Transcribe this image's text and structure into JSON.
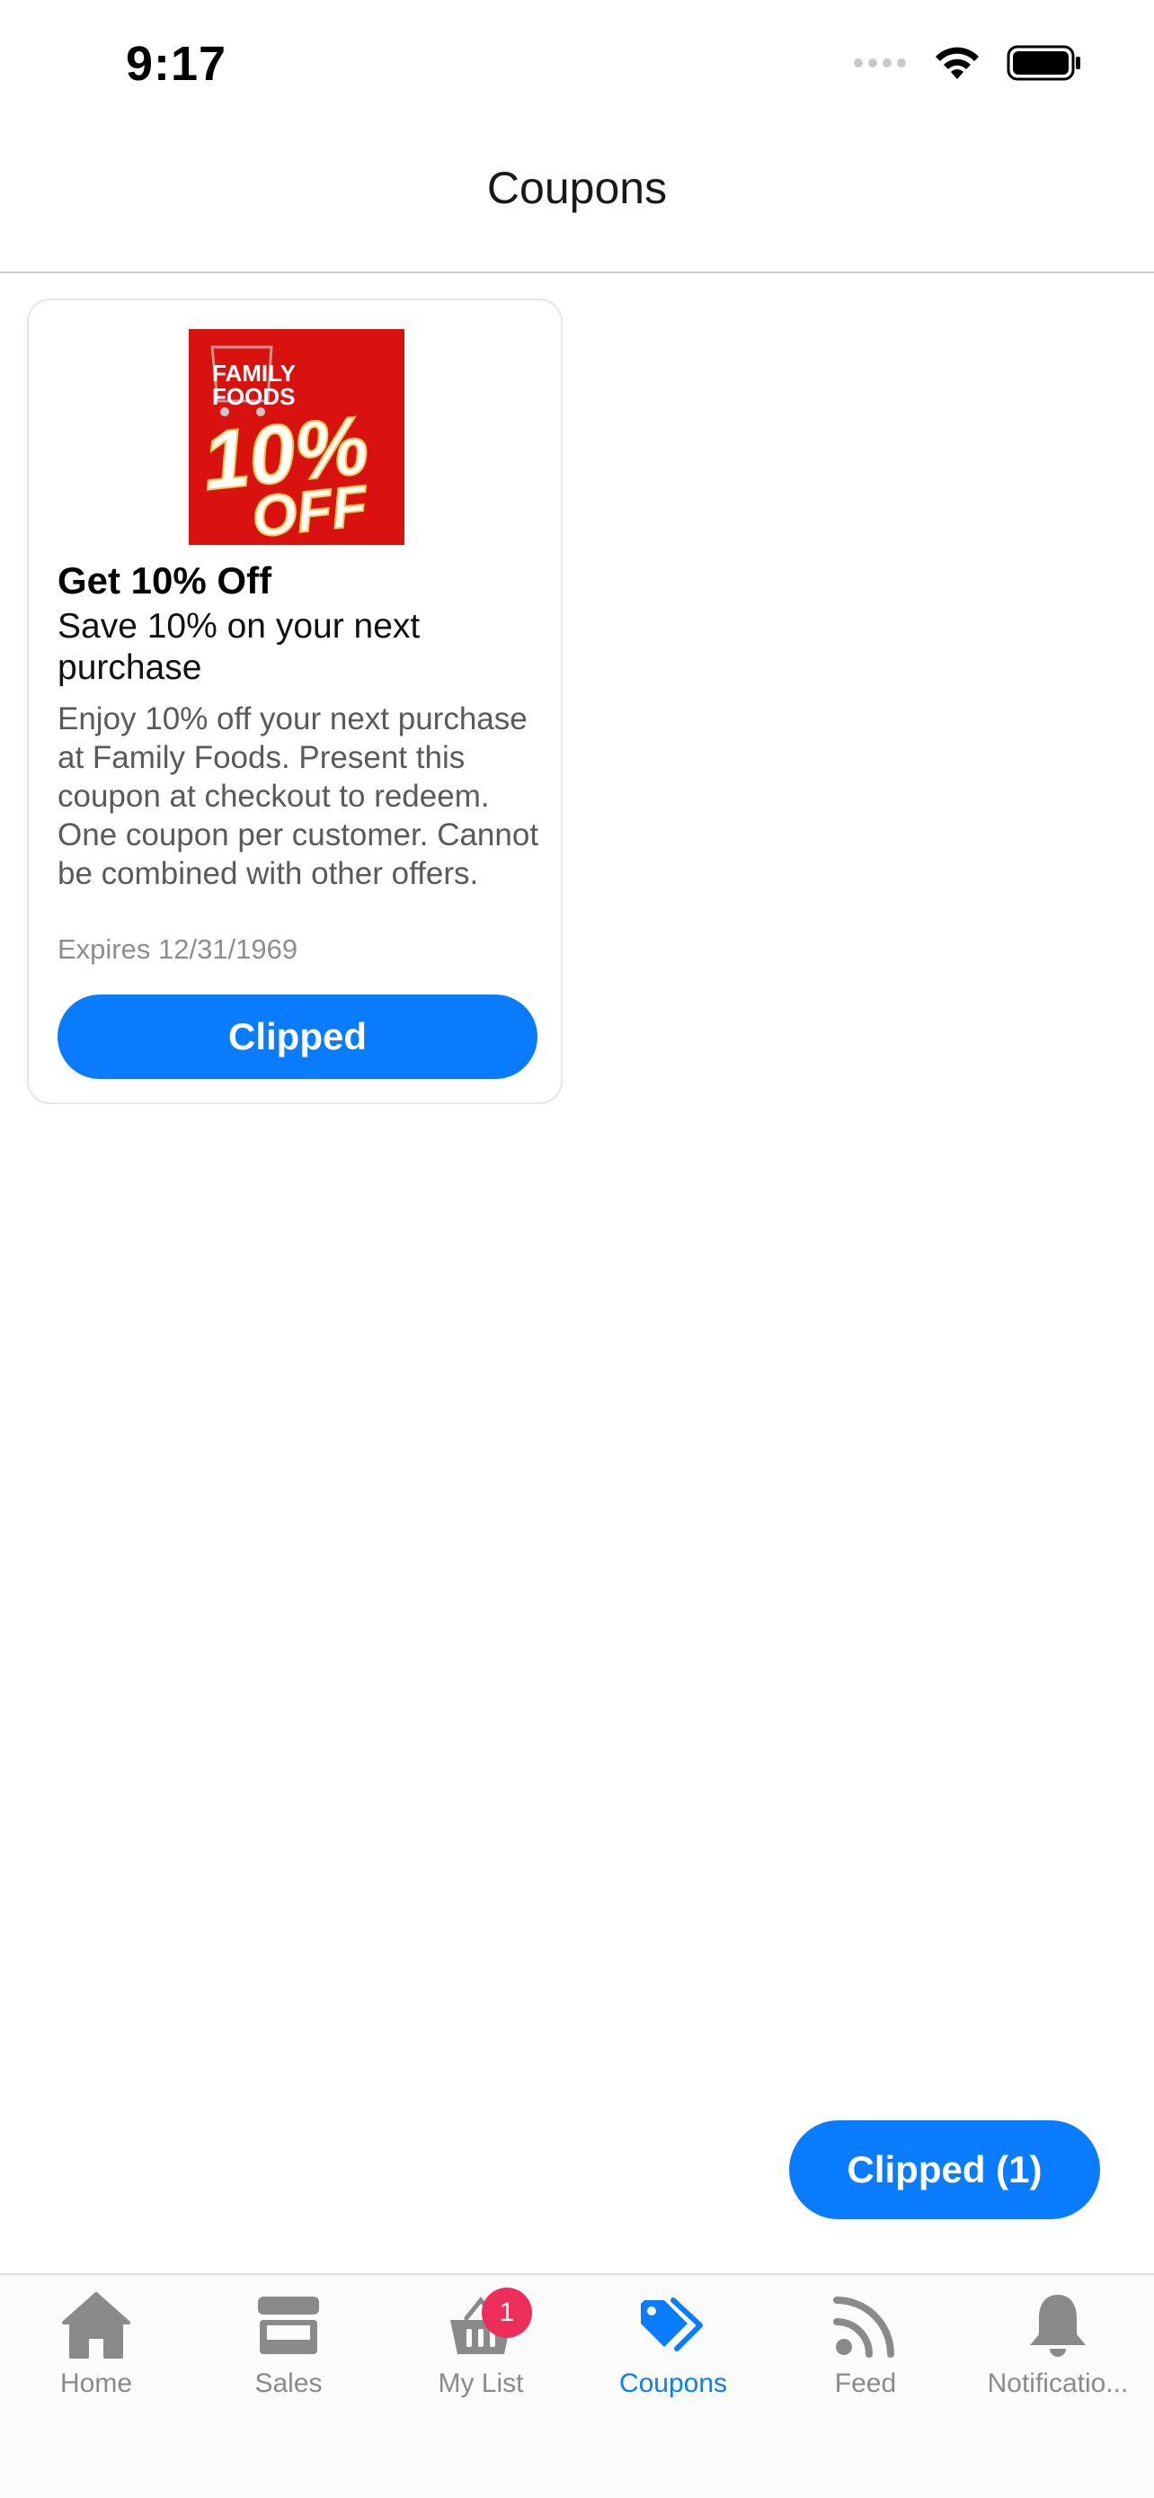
{
  "status_bar": {
    "time": "9:17"
  },
  "header": {
    "title": "Coupons"
  },
  "coupon": {
    "image_brand_line1": "FAMILY",
    "image_brand_line2": "FOODS",
    "image_offer_big": "10%",
    "image_offer_small": "OFF",
    "title": "Get 10% Off",
    "subtitle": "Save 10% on your next purchase",
    "description": "Enjoy 10% off your next purchase at Family Foods. Present this coupon at checkout to redeem. One coupon per customer. Cannot be combined with other offers.",
    "expiry": "Expires 12/31/1969",
    "button_label": "Clipped",
    "image_bg_color": "#d9120f"
  },
  "floating_button": {
    "label": "Clipped (1)"
  },
  "tab_bar": {
    "active_color": "#0a7cff",
    "inactive_color": "#8a8a8a",
    "tabs": [
      {
        "label": "Home",
        "icon": "home-icon"
      },
      {
        "label": "Sales",
        "icon": "store-icon"
      },
      {
        "label": "My List",
        "icon": "basket-icon",
        "badge": "1"
      },
      {
        "label": "Coupons",
        "icon": "tags-icon",
        "active": true
      },
      {
        "label": "Feed",
        "icon": "rss-icon"
      },
      {
        "label": "Notificatio...",
        "icon": "bell-icon"
      }
    ]
  }
}
